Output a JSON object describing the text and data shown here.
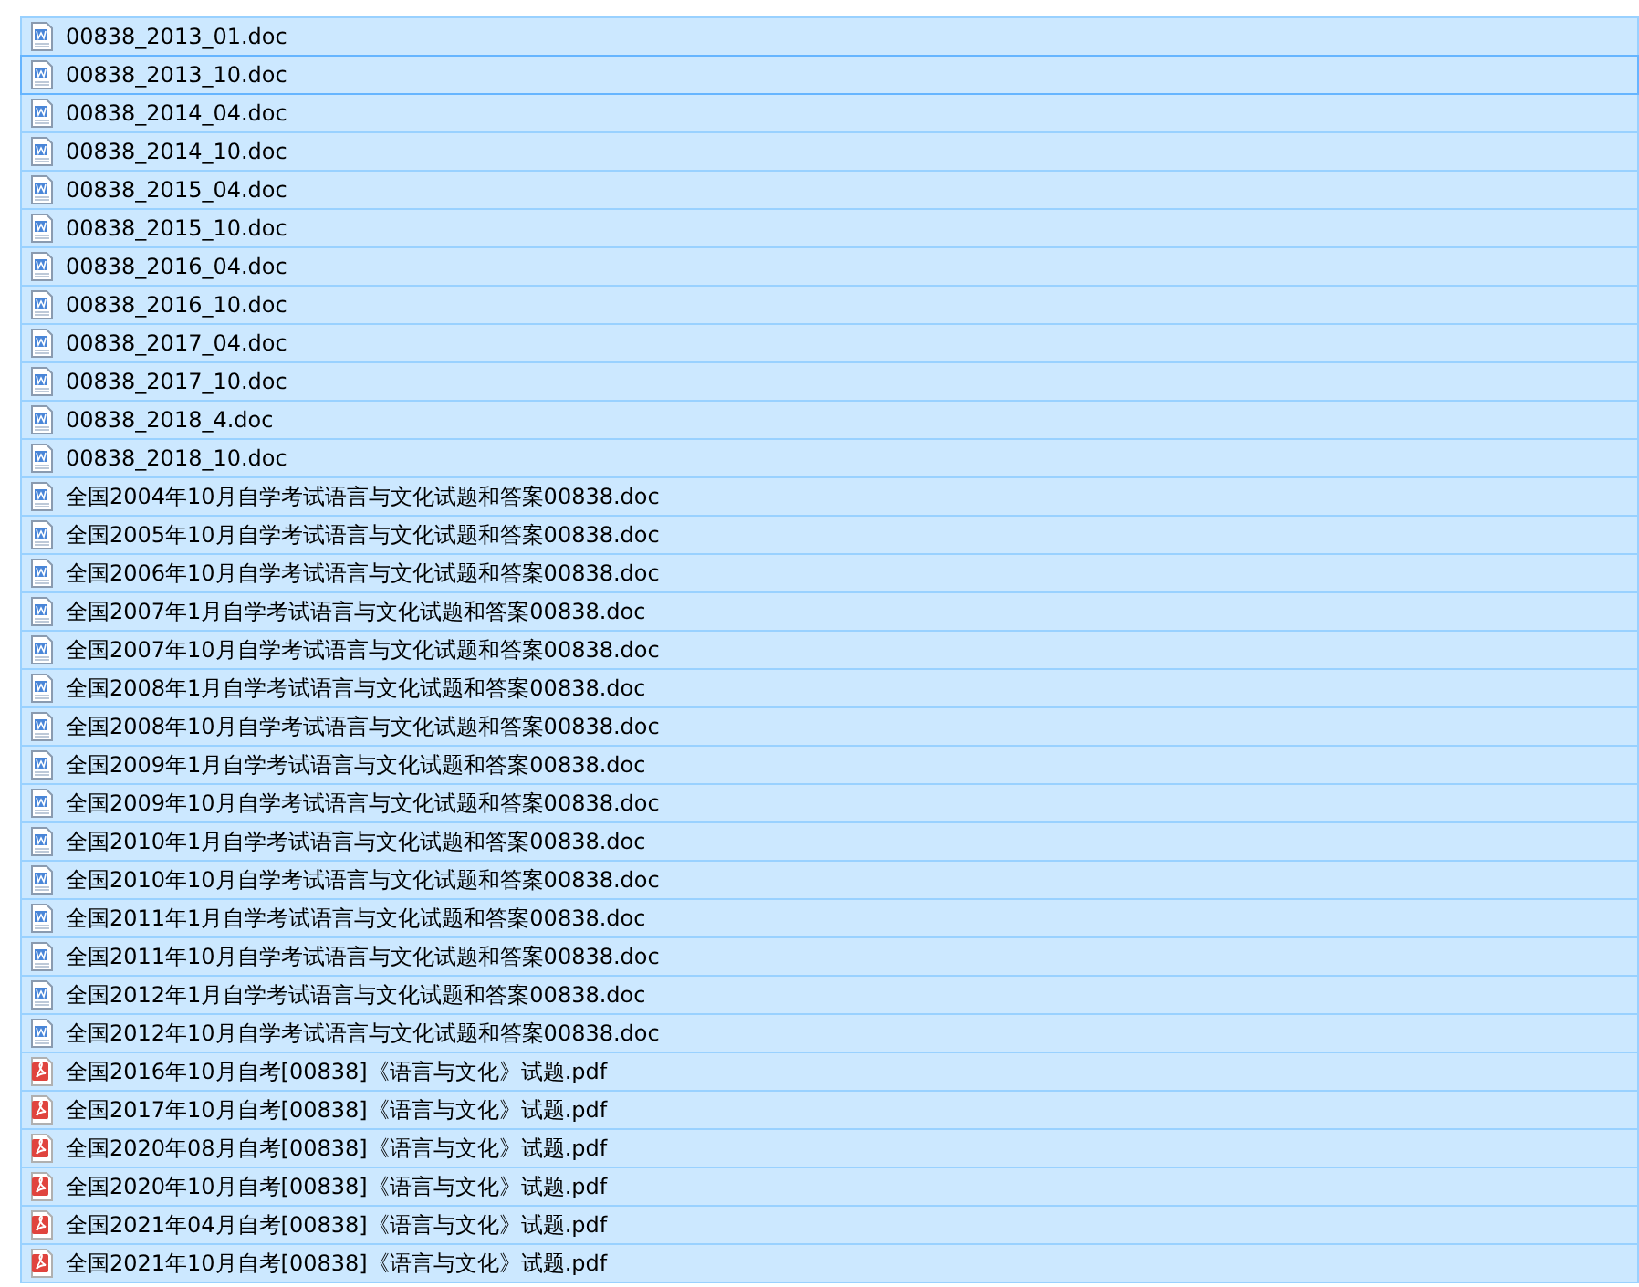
{
  "files": [
    {
      "name": "00838_2013_01.doc",
      "kind": "doc",
      "selected": true,
      "focused": false
    },
    {
      "name": "00838_2013_10.doc",
      "kind": "doc",
      "selected": true,
      "focused": true
    },
    {
      "name": "00838_2014_04.doc",
      "kind": "doc",
      "selected": true,
      "focused": false
    },
    {
      "name": "00838_2014_10.doc",
      "kind": "doc",
      "selected": true,
      "focused": false
    },
    {
      "name": "00838_2015_04.doc",
      "kind": "doc",
      "selected": true,
      "focused": false
    },
    {
      "name": "00838_2015_10.doc",
      "kind": "doc",
      "selected": true,
      "focused": false
    },
    {
      "name": "00838_2016_04.doc",
      "kind": "doc",
      "selected": true,
      "focused": false
    },
    {
      "name": "00838_2016_10.doc",
      "kind": "doc",
      "selected": true,
      "focused": false
    },
    {
      "name": "00838_2017_04.doc",
      "kind": "doc",
      "selected": true,
      "focused": false
    },
    {
      "name": "00838_2017_10.doc",
      "kind": "doc",
      "selected": true,
      "focused": false
    },
    {
      "name": "00838_2018_4.doc",
      "kind": "doc",
      "selected": true,
      "focused": false
    },
    {
      "name": "00838_2018_10.doc",
      "kind": "doc",
      "selected": true,
      "focused": false
    },
    {
      "name": "全国2004年10月自学考试语言与文化试题和答案00838.doc",
      "kind": "doc",
      "selected": true,
      "focused": false
    },
    {
      "name": "全国2005年10月自学考试语言与文化试题和答案00838.doc",
      "kind": "doc",
      "selected": true,
      "focused": false
    },
    {
      "name": "全国2006年10月自学考试语言与文化试题和答案00838.doc",
      "kind": "doc",
      "selected": true,
      "focused": false
    },
    {
      "name": "全国2007年1月自学考试语言与文化试题和答案00838.doc",
      "kind": "doc",
      "selected": true,
      "focused": false
    },
    {
      "name": "全国2007年10月自学考试语言与文化试题和答案00838.doc",
      "kind": "doc",
      "selected": true,
      "focused": false
    },
    {
      "name": "全国2008年1月自学考试语言与文化试题和答案00838.doc",
      "kind": "doc",
      "selected": true,
      "focused": false
    },
    {
      "name": "全国2008年10月自学考试语言与文化试题和答案00838.doc",
      "kind": "doc",
      "selected": true,
      "focused": false
    },
    {
      "name": "全国2009年1月自学考试语言与文化试题和答案00838.doc",
      "kind": "doc",
      "selected": true,
      "focused": false
    },
    {
      "name": "全国2009年10月自学考试语言与文化试题和答案00838.doc",
      "kind": "doc",
      "selected": true,
      "focused": false
    },
    {
      "name": "全国2010年1月自学考试语言与文化试题和答案00838.doc",
      "kind": "doc",
      "selected": true,
      "focused": false
    },
    {
      "name": "全国2010年10月自学考试语言与文化试题和答案00838.doc",
      "kind": "doc",
      "selected": true,
      "focused": false
    },
    {
      "name": "全国2011年1月自学考试语言与文化试题和答案00838.doc",
      "kind": "doc",
      "selected": true,
      "focused": false
    },
    {
      "name": "全国2011年10月自学考试语言与文化试题和答案00838.doc",
      "kind": "doc",
      "selected": true,
      "focused": false
    },
    {
      "name": "全国2012年1月自学考试语言与文化试题和答案00838.doc",
      "kind": "doc",
      "selected": true,
      "focused": false
    },
    {
      "name": "全国2012年10月自学考试语言与文化试题和答案00838.doc",
      "kind": "doc",
      "selected": true,
      "focused": false
    },
    {
      "name": "全国2016年10月自考[00838]《语言与文化》试题.pdf",
      "kind": "pdf",
      "selected": true,
      "focused": false
    },
    {
      "name": "全国2017年10月自考[00838]《语言与文化》试题.pdf",
      "kind": "pdf",
      "selected": true,
      "focused": false
    },
    {
      "name": "全国2020年08月自考[00838]《语言与文化》试题.pdf",
      "kind": "pdf",
      "selected": true,
      "focused": false
    },
    {
      "name": "全国2020年10月自考[00838]《语言与文化》试题.pdf",
      "kind": "pdf",
      "selected": true,
      "focused": false
    },
    {
      "name": "全国2021年04月自考[00838]《语言与文化》试题.pdf",
      "kind": "pdf",
      "selected": true,
      "focused": false
    },
    {
      "name": "全国2021年10月自考[00838]《语言与文化》试题.pdf",
      "kind": "pdf",
      "selected": true,
      "focused": false
    }
  ]
}
